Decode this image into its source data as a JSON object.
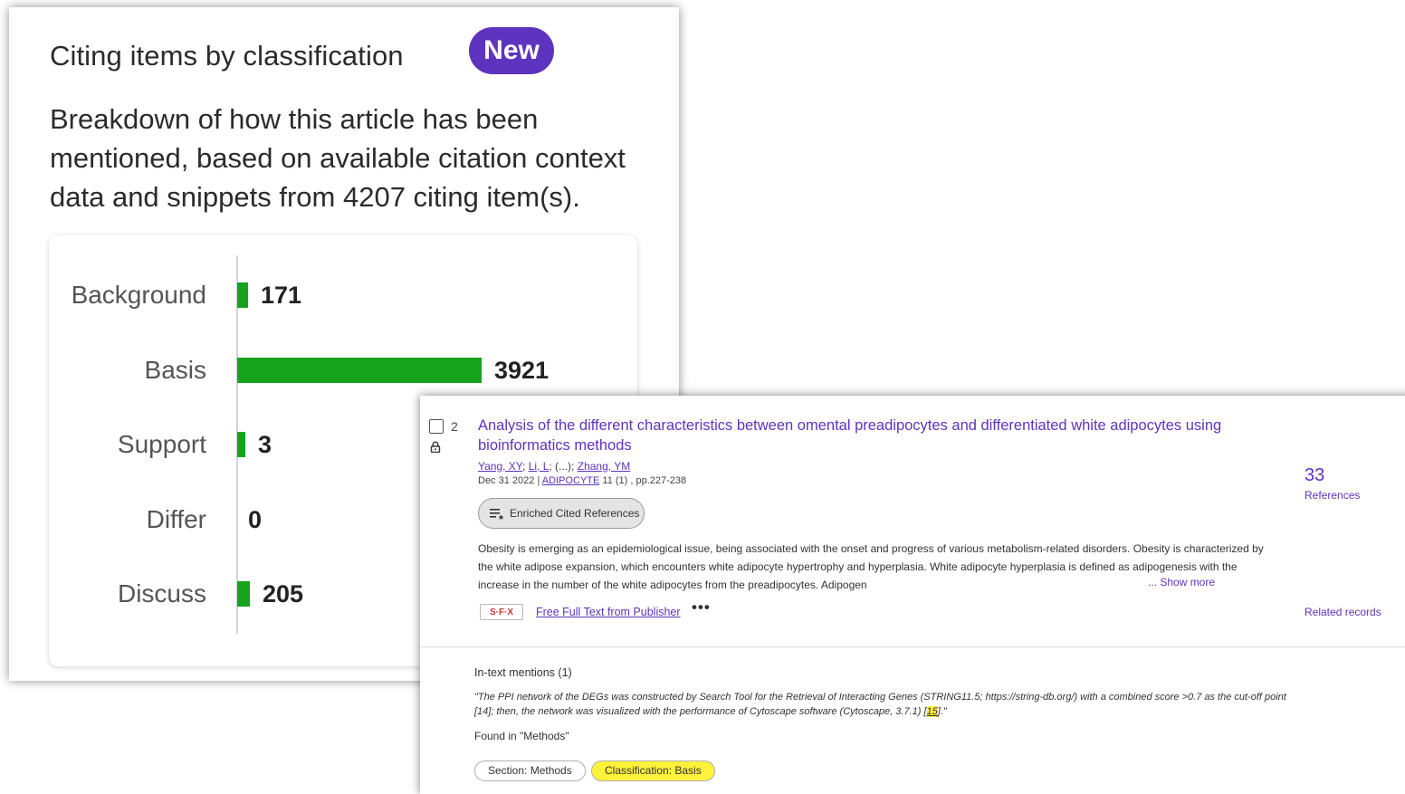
{
  "classification_panel": {
    "title": "Citing items by classification",
    "badge": "New",
    "description": "Breakdown of how this article has been mentioned, based on available citation context data and snippets from 4207 citing item(s).",
    "bar_color": "#16a21c",
    "badge_color": "#5e33bf"
  },
  "chart_data": {
    "type": "bar",
    "orientation": "horizontal",
    "categories": [
      "Background",
      "Basis",
      "Support",
      "Differ",
      "Discuss"
    ],
    "values": [
      171,
      3921,
      3,
      0,
      205
    ],
    "value_labels": [
      "171",
      "3921",
      "3",
      "0",
      "205"
    ],
    "title": "",
    "xlabel": "",
    "ylabel": "",
    "xlim": [
      0,
      3921
    ],
    "grid": false
  },
  "record": {
    "checkbox_checked": false,
    "number": "2",
    "title": "Analysis of the different characteristics between omental preadipocytes and differentiated white adipocytes using bioinformatics methods",
    "authors": {
      "a1": "Yang, XY",
      "sep1": "; ",
      "a2": "Li, L",
      "sep2": "; (...); ",
      "a3": "Zhang, YM"
    },
    "date": "Dec 31 2022",
    "date_sep": " | ",
    "journal": "ADIPOCYTE",
    "volume_pages": " 11 (1) , pp.227-238",
    "enriched_label": "Enriched Cited References",
    "abstract": "Obesity is emerging as an epidemiological issue, being associated with the onset and progress of various metabolism-related disorders. Obesity is characterized by the white adipose expansion, which encounters white adipocyte hypertrophy and hyperplasia. White adipocyte hyperplasia is defined as adipogenesis with the increase in the number of the white adipocytes from the preadipocytes. Adipogen",
    "show_more": "... Show more",
    "sfx_label": "S·F·X",
    "full_text_link": "Free Full Text from Publisher",
    "more_options": "•••",
    "references_count": "33",
    "references_label": "References",
    "related_records": "Related records",
    "mentions": {
      "title": "In-text mentions (1)",
      "quote_before": "\"The PPI network of the DEGs was constructed by Search Tool for the Retrieval of Interacting Genes (STRING11.5; https://string-db.org/) with a combined score >0.7 as the cut-off point [14]; then, the network was visualized with the performance of Cytoscape software (Cytoscape, 3.7.1) [",
      "quote_highlight": "15",
      "quote_after": "].\"",
      "found_in": "Found in \"Methods\"",
      "section_chip": "Section: Methods",
      "classification_chip": "Classification: Basis"
    }
  }
}
